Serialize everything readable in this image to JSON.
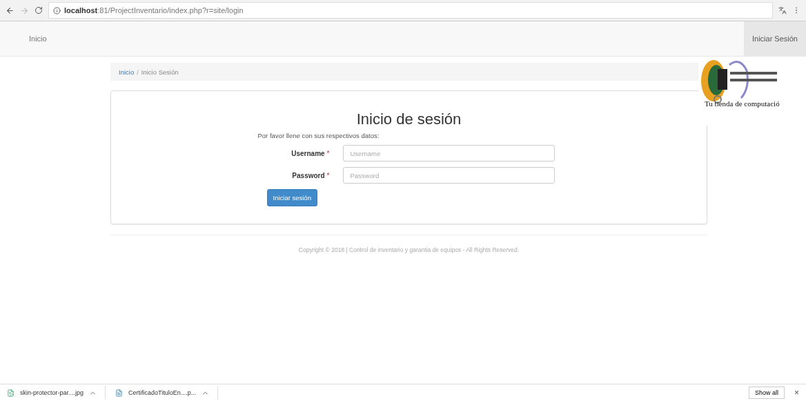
{
  "browser": {
    "url_host": "localhost",
    "url_rest": ":81/ProjectInventario/index.php?r=site/login"
  },
  "navbar": {
    "brand": "Inicio",
    "login_link": "Iniciar Sesión",
    "login_active": true
  },
  "breadcrumb": {
    "separator": "/",
    "items": [
      {
        "label": "Inicio",
        "link": true
      },
      {
        "label": "Inicio Sesión",
        "link": false
      }
    ]
  },
  "logo": {
    "tagline": "Tu tienda de computació"
  },
  "login": {
    "title": "Inicio de sesión",
    "intro": "Por favor llene con sus respectivos datos:",
    "fields": [
      {
        "label": "Username",
        "required_mark": "*",
        "placeholder": "Username"
      },
      {
        "label": "Password",
        "required_mark": "*",
        "placeholder": "Password"
      }
    ],
    "submit": "Iniciar sesión"
  },
  "footer": "Copyright © 2018 | Control de inventario y garantia de equipos - All Rights Reserved.",
  "downloads": [
    {
      "name": "skin-protector-par....jpg",
      "kind": "image"
    },
    {
      "name": "CertificadoTituloEn....p...",
      "kind": "document"
    }
  ],
  "download_bar": {
    "show_all": "Show all",
    "close": "×"
  }
}
